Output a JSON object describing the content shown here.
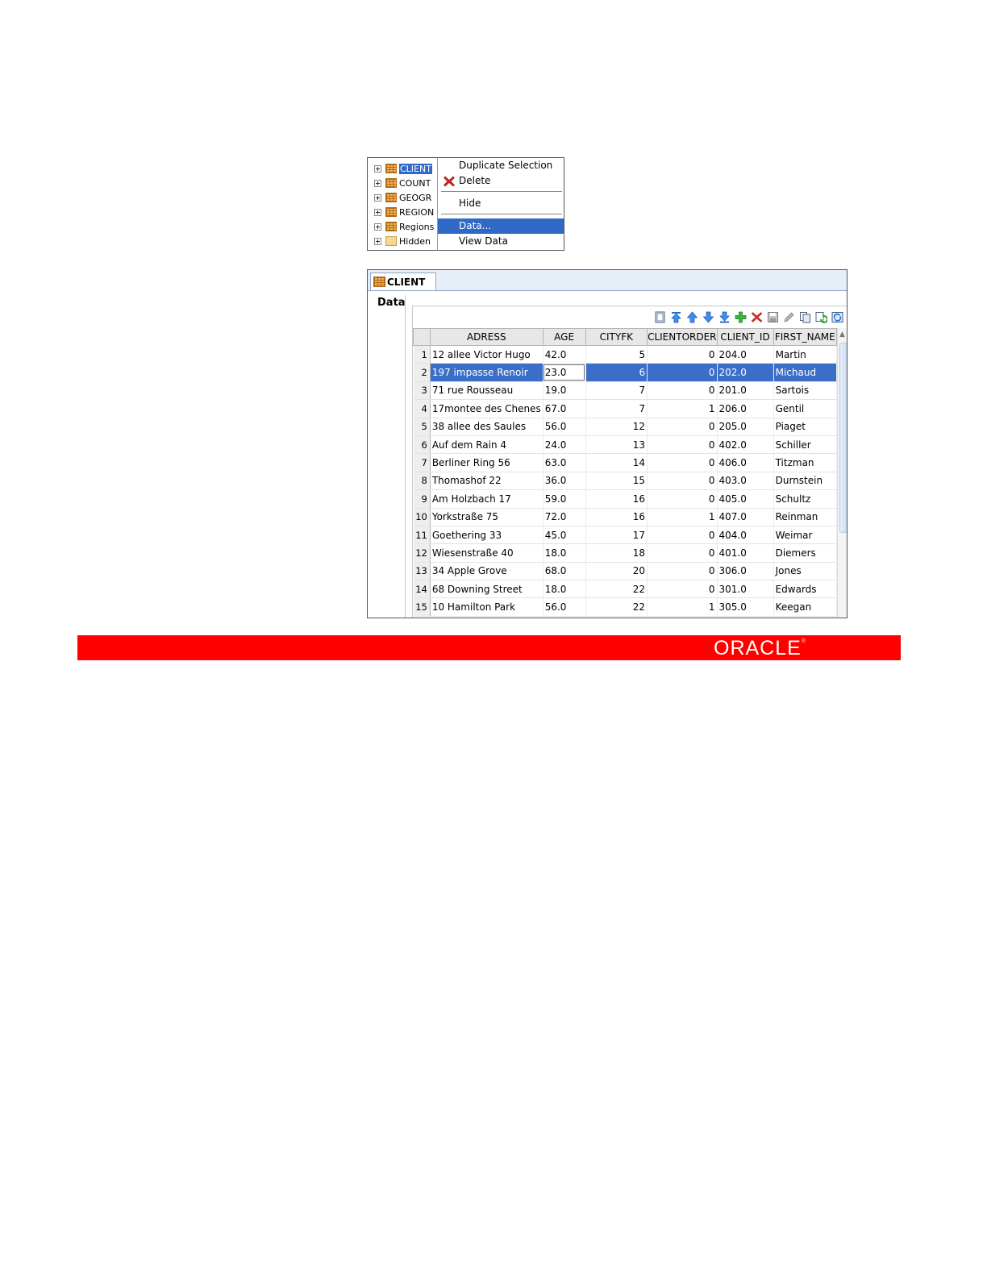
{
  "tree": {
    "items": [
      {
        "label": "CLIENT",
        "selected": true,
        "icon": "table-icon"
      },
      {
        "label": "COUNT",
        "icon": "table-icon"
      },
      {
        "label": "GEOGR",
        "icon": "table-icon"
      },
      {
        "label": "REGION",
        "icon": "table-icon"
      },
      {
        "label": "Regions",
        "icon": "table-icon"
      },
      {
        "label": "Hidden",
        "icon": "hidden-table-icon"
      }
    ]
  },
  "context_menu": {
    "items": [
      {
        "label": "Duplicate Selection"
      },
      {
        "label": "Delete",
        "icon": "delete-x-icon"
      },
      {
        "label": "Hide"
      },
      {
        "label": "Data...",
        "highlighted": true
      },
      {
        "label": "View Data"
      }
    ]
  },
  "editor": {
    "tab_label": "CLIENT",
    "side_label": "Data",
    "columns": [
      "ADRESS",
      "AGE",
      "CITYFK",
      "CLIENTORDER",
      "CLIENT_ID",
      "FIRST_NAME"
    ],
    "selected_row": 2,
    "rows": [
      [
        "1",
        "12 allee Victor Hugo",
        "42.0",
        "5",
        "0",
        "204.0",
        "Martin"
      ],
      [
        "2",
        "197 impasse Renoir",
        "23.0",
        "6",
        "0",
        "202.0",
        "Michaud"
      ],
      [
        "3",
        "71 rue Rousseau",
        "19.0",
        "7",
        "0",
        "201.0",
        "Sartois"
      ],
      [
        "4",
        "17montee des Chenes",
        "67.0",
        "7",
        "1",
        "206.0",
        "Gentil"
      ],
      [
        "5",
        "38 allee des Saules",
        "56.0",
        "12",
        "0",
        "205.0",
        "Piaget"
      ],
      [
        "6",
        "Auf dem Rain 4",
        "24.0",
        "13",
        "0",
        "402.0",
        "Schiller"
      ],
      [
        "7",
        "Berliner Ring 56",
        "63.0",
        "14",
        "0",
        "406.0",
        "Titzman"
      ],
      [
        "8",
        "Thomashof 22",
        "36.0",
        "15",
        "0",
        "403.0",
        "Durnstein"
      ],
      [
        "9",
        "Am Holzbach 17",
        "59.0",
        "16",
        "0",
        "405.0",
        "Schultz"
      ],
      [
        "10",
        "Yorkstraße 75",
        "72.0",
        "16",
        "1",
        "407.0",
        "Reinman"
      ],
      [
        "11",
        "Goethering 33",
        "45.0",
        "17",
        "0",
        "404.0",
        "Weimar"
      ],
      [
        "12",
        "Wiesenstraße 40",
        "18.0",
        "18",
        "0",
        "401.0",
        "Diemers"
      ],
      [
        "13",
        "34 Apple Grove",
        "68.0",
        "20",
        "0",
        "306.0",
        "Jones"
      ],
      [
        "14",
        "68 Downing Street",
        "18.0",
        "22",
        "0",
        "301.0",
        "Edwards"
      ],
      [
        "15",
        "10 Hamilton Park",
        "56.0",
        "22",
        "1",
        "305.0",
        "Keegan"
      ]
    ],
    "toolbar_icons": [
      "view-icon",
      "move-first-icon",
      "move-up-icon",
      "move-down-icon",
      "move-last-icon",
      "add-row-icon",
      "delete-row-icon",
      "save-icon",
      "edit-icon",
      "copy-icon",
      "refresh-icon",
      "sync-icon"
    ]
  },
  "banner": {
    "logo_text": "ORACLE",
    "logo_mark": "®",
    "color": "#ff0000"
  }
}
